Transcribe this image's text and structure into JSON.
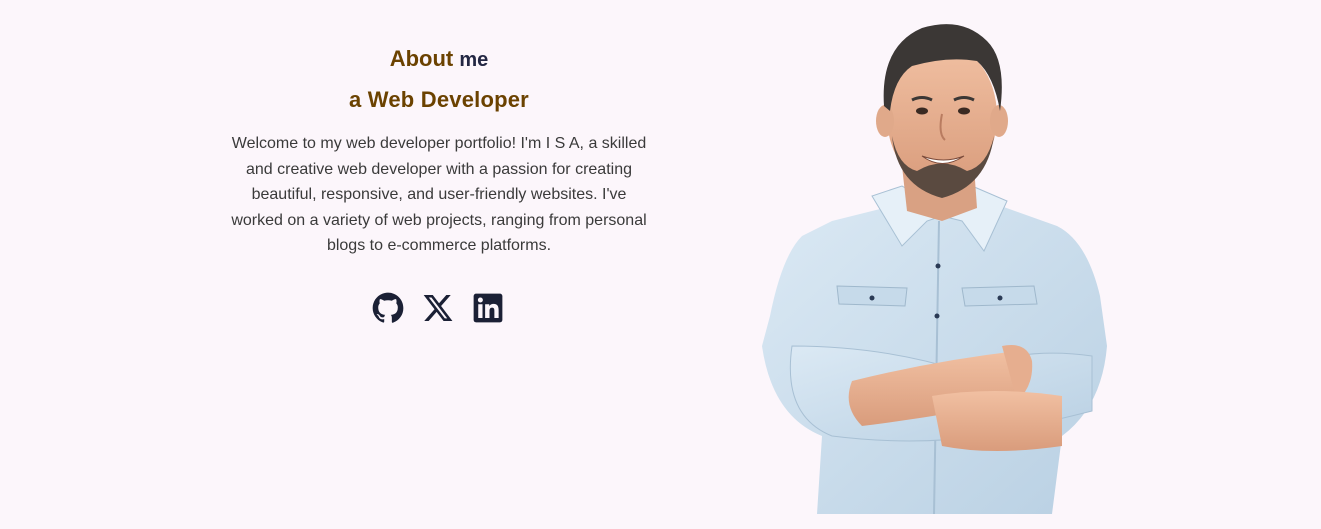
{
  "about": {
    "title_accent": "About",
    "title_rest": "me",
    "subtitle": "a Web Developer",
    "description": "Welcome to my web developer portfolio! I'm I S A, a skilled and creative web developer with a passion for creating beautiful, responsive, and user-friendly websites. I've worked on a variety of web projects, ranging from personal blogs to e-commerce platforms."
  },
  "socials": [
    {
      "icon": "github-icon"
    },
    {
      "icon": "x-twitter-icon"
    },
    {
      "icon": "linkedin-icon"
    }
  ],
  "colors": {
    "background": "#fcf6fb",
    "accent": "#6b4200",
    "dark": "#232743",
    "text": "#3a3a3a",
    "shirt": "#cfe2f0"
  }
}
